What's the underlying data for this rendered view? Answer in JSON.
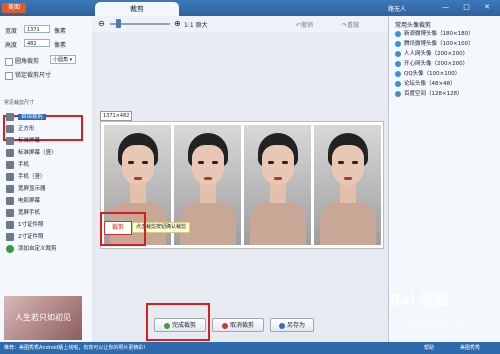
{
  "title_bar": {
    "app_name": "美图",
    "tab_label": "裁剪",
    "user": "路无人",
    "window_controls": "— □ ✕"
  },
  "toolbar": {
    "zoom_minus": "⊖",
    "zoom_plus": "⊕",
    "ratio_label": "1:1 原大",
    "undo": "↶撤销",
    "redo": "↷重做"
  },
  "left_panel": {
    "width_label": "宽度",
    "width_value": "1371",
    "width_unit": "像素",
    "height_label": "高度",
    "height_value": "482",
    "height_unit": "像素",
    "round_crop_label": "圆角裁剪",
    "round_crop_option": "小圆角 ▾",
    "lock_ratio_label": "锁定裁剪尺寸",
    "section_title": "常见裁剪尺寸",
    "items": [
      {
        "label": "自由裁剪"
      },
      {
        "label": "正方形"
      },
      {
        "label": "标准屏幕"
      },
      {
        "label": "标准屏幕（竖）"
      },
      {
        "label": "手机"
      },
      {
        "label": "手机（竖）"
      },
      {
        "label": "宽屏显示器"
      },
      {
        "label": "电影屏幕"
      },
      {
        "label": "宽屏手机"
      },
      {
        "label": "1寸证件照"
      },
      {
        "label": "2寸证件照"
      },
      {
        "label": "添加自定义裁剪"
      }
    ],
    "ad_text": "人生若只如初见"
  },
  "canvas": {
    "dimension_label": "1371×482",
    "crop_button": "裁剪",
    "hint_text": "点击裁剪按钮确认裁剪",
    "done_button": "完成裁剪",
    "cancel_button": "取消裁剪",
    "save_as_button": "另存为"
  },
  "right_panel": {
    "title": "常用头像裁剪",
    "items": [
      {
        "label": "新浪微博头像（180×180）"
      },
      {
        "label": "腾讯微博头像（100×100）"
      },
      {
        "label": "人人网头像（200×200）"
      },
      {
        "label": "开心网头像（200×200）"
      },
      {
        "label": "QQ头像（100×100）"
      },
      {
        "label": "论坛头像（48×48）"
      },
      {
        "label": "百度空间（128×128）"
      }
    ]
  },
  "status_bar": {
    "left_text": "推荐：美图秀秀Android版上线啦，有效可以让你的照片更精彩！",
    "right1": "帮助",
    "right2": "美图秀秀"
  },
  "watermark": {
    "text": "Bai 经验",
    "sub": "jingyan.baidu.com"
  }
}
